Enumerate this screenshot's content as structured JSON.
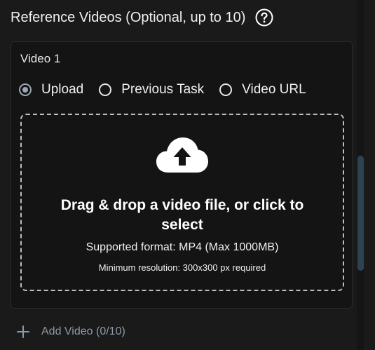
{
  "section": {
    "title": "Reference Videos (Optional, up to 10)",
    "help_icon": "question-circle-icon"
  },
  "video_card": {
    "title": "Video 1",
    "source_options": [
      {
        "label": "Upload",
        "selected": true
      },
      {
        "label": "Previous Task",
        "selected": false
      },
      {
        "label": "Video URL",
        "selected": false
      }
    ],
    "dropzone": {
      "icon": "cloud-upload-icon",
      "main_text": "Drag & drop a video file, or click to select",
      "format_text": "Supported format: MP4 (Max 1000MB)",
      "resolution_text": "Minimum resolution: 300x300 px required"
    }
  },
  "add_video": {
    "icon": "plus-icon",
    "label": "Add Video (0/10)"
  },
  "colors": {
    "background": "#1a1a1a",
    "card_background": "#141414",
    "radio_selected": "#9aa7b2",
    "muted_accent": "#8d9aa6",
    "scrollbar_thumb": "#2e4352"
  }
}
